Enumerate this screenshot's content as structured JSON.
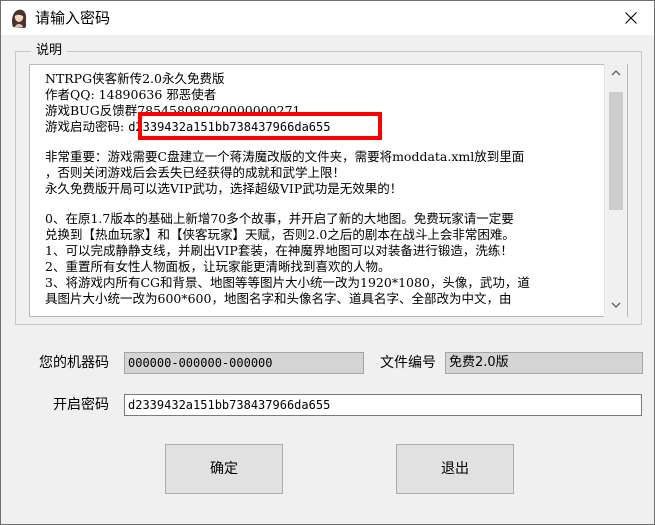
{
  "window": {
    "title": "请输入密码"
  },
  "description": {
    "caption": "说明",
    "lines": [
      "NTRPG侠客新传2.0永久免费版",
      "作者QQ: 14890636  邪恶使者",
      "游戏BUG反馈群785458080/20000000271",
      "游戏启动密码: ",
      "",
      "非常重要：游戏需要C盘建立一个蒋涛魔改版的文件夹，需要将moddata.xml放到里面",
      "，否则关闭游戏后会丢失已经获得的成就和武学上限！",
      "永久免费版开局可以选VIP武功，选择超级VIP武功是无效果的！",
      "",
      "0、在原1.7版本的基础上新增70多个故事，并开启了新的大地图。免费玩家请一定要",
      "兑换到【热血玩家】和【侠客玩家】天赋，否则2.0之后的剧本在战斗上会非常困难。",
      "1、可以完成静静支线，并刷出VIP套装，在神魔界地图可以对装备进行锻造，洗练！",
      "2、重置所有女性人物面板，让玩家能更清晰找到喜欢的人物。",
      "3、将游戏内所有CG和背景、地图等等图片大小统一改为1920*1080，头像，武功，道",
      "具图片大小统一改为600*600，地图名字和头像名字、道具名字、全部改为中文，由"
    ],
    "launch_password_inline": "d2339432a151bb738437966da655"
  },
  "form": {
    "machine_code_label": "您的机器码",
    "machine_code_value": "000000-000000-000000",
    "file_number_label": "文件编号",
    "file_number_value": "免费2.0版",
    "password_label": "开启密码",
    "password_value": "d2339432a151bb738437966da655"
  },
  "buttons": {
    "confirm": "确定",
    "exit": "退出"
  },
  "colors": {
    "highlight": "#ff0000",
    "readonly_field": "#d4d4d4",
    "button_face": "#e1e1e1"
  },
  "icons": {
    "title": "girl-avatar-icon",
    "close": "close-icon"
  }
}
